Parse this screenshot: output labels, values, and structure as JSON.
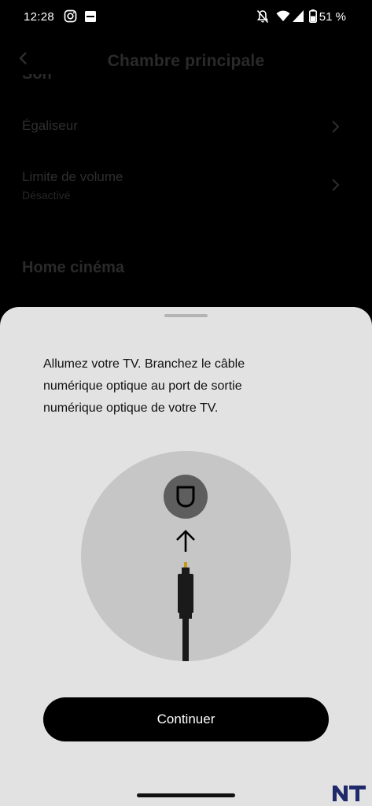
{
  "status_bar": {
    "time": "12:28",
    "battery": "51 %",
    "icons": [
      "instagram-icon",
      "notification-app-icon",
      "bell-off-icon",
      "wifi-icon",
      "signal-icon",
      "battery-icon"
    ]
  },
  "background_screen": {
    "title": "Chambre principale",
    "section_son": "Son",
    "rows": [
      {
        "label": "Égaliseur",
        "sublabel": ""
      },
      {
        "label": "Limite de volume",
        "sublabel": "Désactivé"
      }
    ],
    "section_home": "Home cinéma"
  },
  "sheet": {
    "instruction": "Allumez votre TV. Branchez le câble numérique optique au port de sortie numérique optique de votre TV.",
    "continue_label": "Continuer"
  },
  "illustration": {
    "icons": [
      "optical-port-icon",
      "arrow-up-icon",
      "optical-cable-icon"
    ]
  },
  "colors": {
    "sheet_background": "#e2e2e2",
    "illustration_circle": "#c6c6c6",
    "port_circle": "#5e5e5e",
    "button_background": "#000000",
    "button_text": "#ffffff",
    "watermark": "#1f2a6b"
  }
}
